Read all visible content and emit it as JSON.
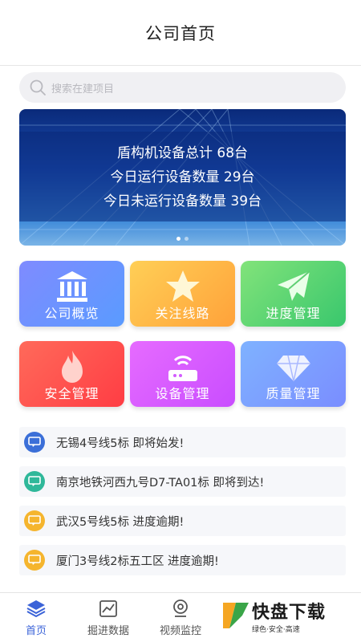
{
  "header": {
    "title": "公司首页"
  },
  "search": {
    "placeholder": "搜索在建项目"
  },
  "banner": {
    "lines": [
      "盾构机设备总计 68台",
      "今日运行设备数量 29台",
      "今日未运行设备数量 39台"
    ]
  },
  "tiles": [
    {
      "label": "公司概览",
      "icon": "bank-icon"
    },
    {
      "label": "关注线路",
      "icon": "star-icon"
    },
    {
      "label": "进度管理",
      "icon": "paper-plane-icon"
    },
    {
      "label": "安全管理",
      "icon": "flame-icon"
    },
    {
      "label": "设备管理",
      "icon": "router-icon"
    },
    {
      "label": "质量管理",
      "icon": "diamond-icon"
    }
  ],
  "notices": [
    {
      "text": "无锡4号线5标   即将始发!",
      "color": "#3b6fd8"
    },
    {
      "text": "南京地铁河西九号D7-TA01标   即将到达!",
      "color": "#2fb89a"
    },
    {
      "text": "武汉5号线5标   进度逾期!",
      "color": "#f5b52e"
    },
    {
      "text": "厦门3号线2标五工区   进度逾期!",
      "color": "#f5b52e"
    }
  ],
  "tabbar": {
    "items": [
      {
        "label": "首页",
        "icon": "layers-icon",
        "active": true
      },
      {
        "label": "掘进数据",
        "icon": "chart-icon",
        "active": false
      },
      {
        "label": "视频监控",
        "icon": "camera-icon",
        "active": false
      }
    ]
  },
  "watermark": {
    "main": "快盘下载",
    "sub": "绿色·安全·高速"
  }
}
